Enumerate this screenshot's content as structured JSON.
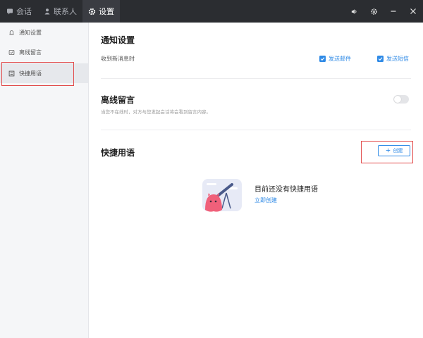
{
  "titlebar": {
    "tabs": [
      {
        "label": "会话",
        "icon": "chat-icon",
        "active": false
      },
      {
        "label": "联系人",
        "icon": "contacts-icon",
        "active": false
      },
      {
        "label": "设置",
        "icon": "gear-icon",
        "active": true
      }
    ],
    "controls": [
      "speaker-icon",
      "settings-icon",
      "minimize-icon",
      "close-icon"
    ]
  },
  "sidebar": {
    "items": [
      {
        "label": "通知设置",
        "icon": "bell-icon",
        "active": false
      },
      {
        "label": "离线留言",
        "icon": "message-icon",
        "active": false
      },
      {
        "label": "快捷用语",
        "icon": "quick-reply-icon",
        "active": true
      }
    ]
  },
  "main": {
    "notify": {
      "title": "通知设置",
      "label": "收到新消息时",
      "options": [
        {
          "label": "发送邮件",
          "checked": true
        },
        {
          "label": "发送短信",
          "checked": true
        }
      ]
    },
    "offline": {
      "title": "离线留言",
      "hint": "当您不在线时，对方与您发起会话将会看到留言内容。",
      "enabled": false
    },
    "quick": {
      "title": "快捷用语",
      "create_label": "创建",
      "empty_title": "目前还没有快捷用语",
      "empty_link": "立即创建"
    }
  },
  "colors": {
    "accent": "#2f8ae6",
    "titlebar": "#2b2d31",
    "highlight_box": "#e24b4b"
  }
}
